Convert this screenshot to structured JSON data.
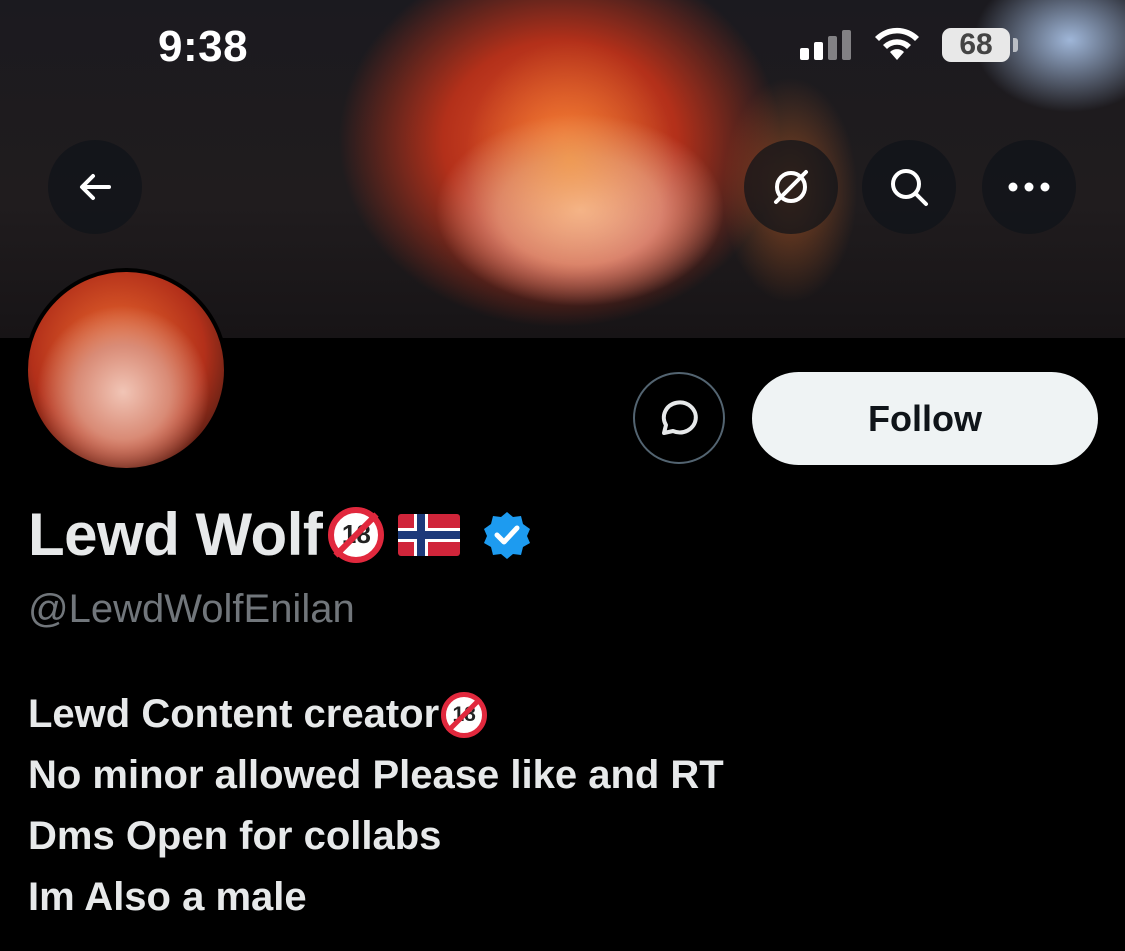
{
  "status_bar": {
    "time": "9:38",
    "battery": "68"
  },
  "header": {
    "back_icon": "arrow-left-icon",
    "grok_icon": "grok-icon",
    "search_icon": "search-icon",
    "more_icon": "more-horizontal-icon"
  },
  "profile": {
    "display_name": "Lewd Wolf",
    "name_badge": "18",
    "flag": "norway-flag",
    "verified": true,
    "handle": "@LewdWolfEnilan",
    "follow_label": "Follow",
    "bio": [
      "Lewd Content creator",
      "No minor allowed Please like and RT",
      "Dms Open for collabs",
      "Im Also a male"
    ]
  },
  "colors": {
    "background": "#000000",
    "primary_text": "#e7e9ea",
    "secondary_text": "#71767b",
    "verified_blue": "#1d9bf0",
    "follow_bg": "#eff3f4"
  }
}
